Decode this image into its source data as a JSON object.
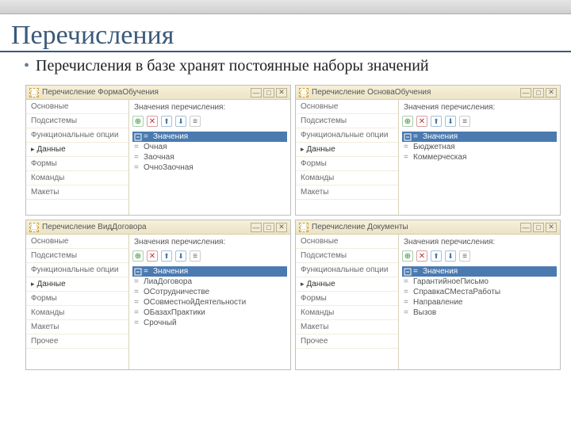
{
  "slide": {
    "title": "Перечисления",
    "bullet": "Перечисления в базе хранят постоянные наборы значений"
  },
  "panels": [
    {
      "title": "Перечисление ФормаОбучения",
      "nav": [
        "Основные",
        "Подсистемы",
        "Функциональные опции",
        "Данные",
        "Формы",
        "Команды",
        "Макеты"
      ],
      "active_index": 3,
      "vals_label": "Значения перечисления:",
      "header": "Значения",
      "values": [
        "Очная",
        "Заочная",
        "ОчноЗаочная"
      ]
    },
    {
      "title": "Перечисление ОсноваОбучения",
      "nav": [
        "Основные",
        "Подсистемы",
        "Функциональные опции",
        "Данные",
        "Формы",
        "Команды",
        "Макеты"
      ],
      "active_index": 3,
      "vals_label": "Значения перечисления:",
      "header": "Значения",
      "values": [
        "Бюджетная",
        "Коммерческая"
      ]
    },
    {
      "title": "Перечисление ВидДоговора",
      "nav": [
        "Основные",
        "Подсистемы",
        "Функциональные опции",
        "Данные",
        "Формы",
        "Команды",
        "Макеты",
        "Прочее"
      ],
      "active_index": 3,
      "vals_label": "Значения перечисления:",
      "header": "Значения",
      "values": [
        "ЛиаДоговора",
        "ОСотрудничестве",
        "ОСовместнойДеятельности",
        "ОБазахПрактики",
        "Срочный"
      ]
    },
    {
      "title": "Перечисление Документы",
      "nav": [
        "Основные",
        "Подсистемы",
        "Функциональные опции",
        "Данные",
        "Формы",
        "Команды",
        "Макеты",
        "Прочее"
      ],
      "active_index": 3,
      "vals_label": "Значения перечисления:",
      "header": "Значения",
      "values": [
        "ГарантийноеПисьмо",
        "СправкаСМестаРаботы",
        "Направление",
        "Вызов"
      ]
    }
  ],
  "toolbar": {
    "add": "⊕",
    "del": "✕",
    "up": "⬆",
    "dn": "⬇",
    "more": "≡"
  },
  "winbtns": {
    "min": "—",
    "max": "□",
    "close": "✕"
  }
}
